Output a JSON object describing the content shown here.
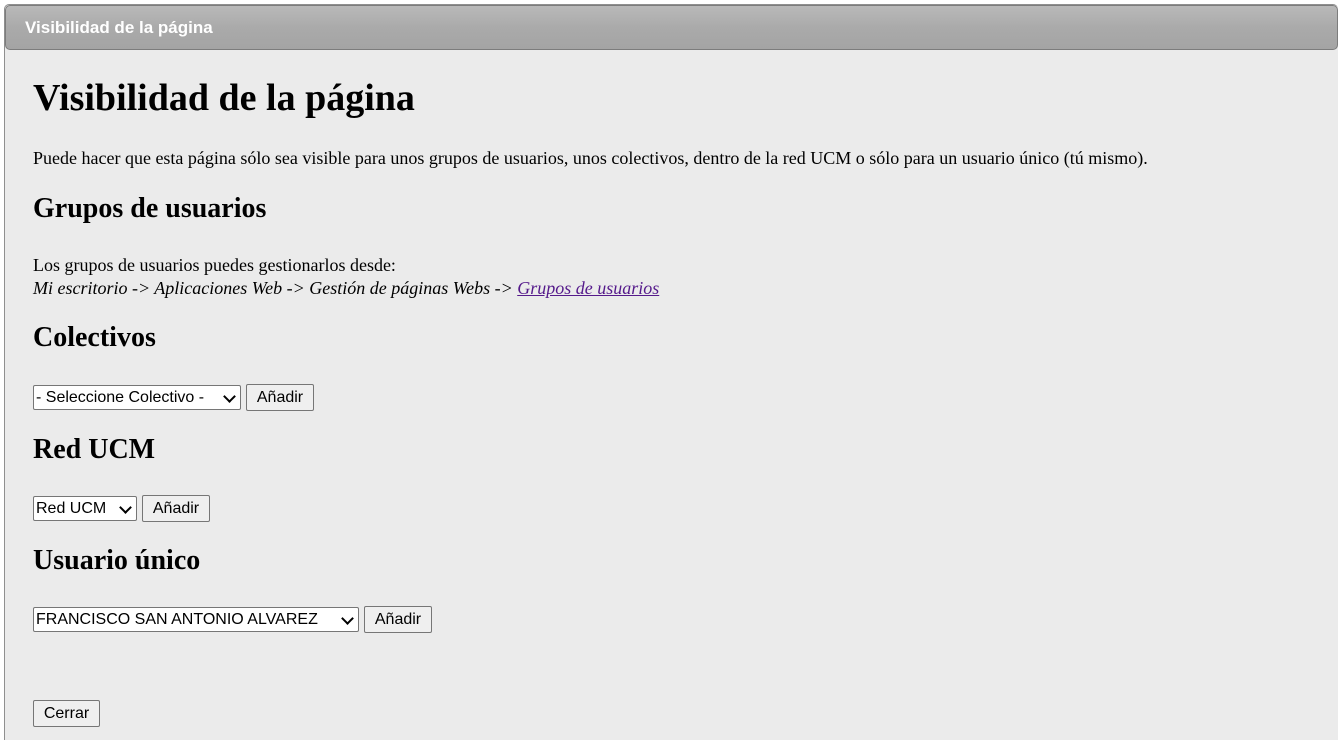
{
  "window": {
    "title": "Visibilidad de la página"
  },
  "page": {
    "heading": "Visibilidad de la página",
    "intro": "Puede hacer que esta página sólo sea visible para unos grupos de usuarios, unos colectivos, dentro de la red UCM o sólo para un usuario único (tú mismo)."
  },
  "groups": {
    "heading": "Grupos de usuarios",
    "text": "Los grupos de usuarios puedes gestionarlos desde:",
    "path_prefix": "Mi escritorio -> Aplicaciones Web -> Gestión de páginas Webs -> ",
    "path_link": "Grupos de usuarios"
  },
  "collectives": {
    "heading": "Colectivos",
    "selected": "- Seleccione Colectivo -",
    "add_label": "Añadir"
  },
  "network": {
    "heading": "Red UCM",
    "selected": "Red UCM",
    "add_label": "Añadir"
  },
  "single_user": {
    "heading": "Usuario único",
    "selected": "FRANCISCO SAN ANTONIO ALVAREZ",
    "add_label": "Añadir"
  },
  "footer": {
    "close_label": "Cerrar"
  },
  "icons": {
    "dropdown": "chevron-down-icon"
  },
  "colors": {
    "titlebar": "#aaaaaa",
    "background": "#ebebeb",
    "link_visited": "#551a8b"
  }
}
